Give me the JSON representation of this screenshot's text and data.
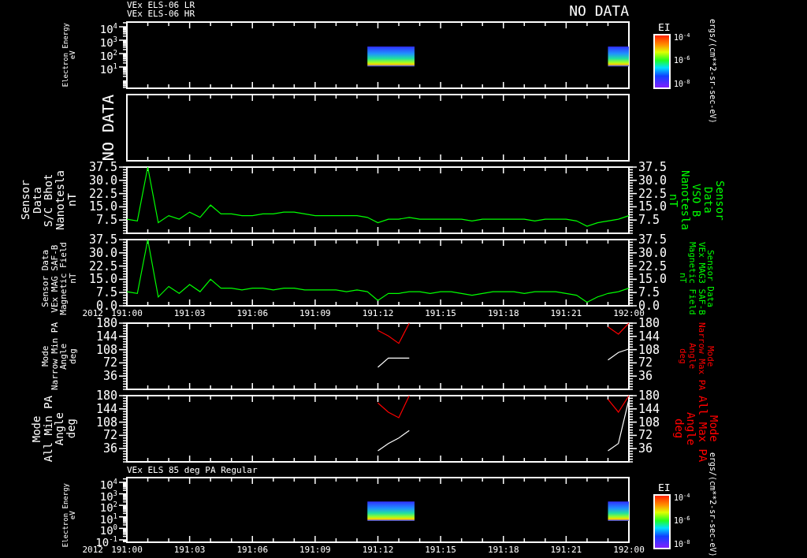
{
  "header": {
    "titles": [
      "VEx ELS-06 LR",
      "VEx ELS-06 HR"
    ],
    "status": "NO DATA"
  },
  "panels": [
    {
      "kind": "spectrogram",
      "label": [
        "Electron Energy",
        "eV"
      ],
      "yticks": [
        "10$^{4}$",
        "10$^{3}$",
        "10$^{2}$",
        "10$^{1}$"
      ],
      "colorbar": {
        "title": "EI",
        "ticks": [
          "10$^{-4}$",
          "10$^{-6}$",
          "10$^{-8}$"
        ],
        "unit": "ergs/(cm**2-sr-sec-eV)"
      }
    },
    {
      "kind": "empty",
      "message": "NO DATA"
    },
    {
      "kind": "line",
      "label": [
        "Sensor Data",
        "S/C Bhot",
        "Nanotesla",
        "nT"
      ],
      "right_label": [
        "Sensor Data",
        "VSO B",
        "Nanotesla",
        "nT"
      ],
      "right_ticks": [
        "37.5",
        "30.0",
        "22.5",
        "15.0",
        "7.5"
      ],
      "chart_data": {
        "type": "line",
        "categories": [
          null,
          null,
          null,
          null,
          null,
          null,
          null,
          null,
          null,
          null,
          null,
          null,
          null,
          null,
          null,
          null,
          null,
          null,
          null,
          null,
          null,
          null,
          null,
          null,
          null,
          null,
          null,
          null,
          null,
          null,
          null,
          null,
          null,
          null,
          null,
          null,
          null,
          null,
          null,
          null,
          null,
          null,
          null,
          null,
          null,
          null,
          null,
          null,
          null
        ],
        "ylim": [
          0,
          37.5
        ],
        "yticks": [
          {
            "value": 37.5,
            "label": "37.5"
          },
          {
            "value": 30,
            "label": "30.0"
          },
          {
            "value": 22.5,
            "label": "22.5"
          },
          {
            "value": 15,
            "label": "15.0"
          },
          {
            "value": 7.5,
            "label": "7.5"
          }
        ],
        "series": [
          {
            "color": "#00ff00",
            "values": [
              8,
              7,
              37.5,
              6,
              10,
              8,
              12,
              9,
              16,
              11,
              11,
              10,
              10,
              11,
              11,
              12,
              12,
              11,
              10,
              10,
              10,
              10,
              10,
              9,
              6,
              8,
              8,
              9,
              8,
              8,
              8,
              8,
              8,
              7,
              8,
              8,
              8,
              8,
              8,
              7,
              8,
              8,
              8,
              7,
              4,
              6,
              7,
              8,
              10
            ]
          }
        ]
      }
    },
    {
      "kind": "line",
      "label": [
        "Sensor Data",
        "VEx MAG SAF-B",
        "Magnetic Field",
        "nT"
      ],
      "right_label": [
        "Sensor Data",
        "VEx MAG3 SAF-B",
        "Magnetic Field",
        "nT"
      ],
      "right_ticks": [
        "37.5",
        "30.0",
        "22.5",
        "15.0",
        "7.5",
        "0.0"
      ],
      "year": "2012",
      "chart_data": {
        "type": "line",
        "categories": [
          "191:00",
          null,
          null,
          null,
          null,
          null,
          "191:03",
          null,
          null,
          null,
          null,
          null,
          "191:06",
          null,
          null,
          null,
          null,
          null,
          "191:09",
          null,
          null,
          null,
          null,
          null,
          "191:12",
          null,
          null,
          null,
          null,
          null,
          "191:15",
          null,
          null,
          null,
          null,
          null,
          "191:18",
          null,
          null,
          null,
          null,
          null,
          "191:21",
          null,
          null,
          null,
          null,
          null,
          "192:00"
        ],
        "ylim": [
          0,
          37.5
        ],
        "yticks": [
          {
            "value": 37.5,
            "label": "37.5"
          },
          {
            "value": 30,
            "label": "30.0"
          },
          {
            "value": 22.5,
            "label": "22.5"
          },
          {
            "value": 15,
            "label": "15.0"
          },
          {
            "value": 7.5,
            "label": "7.5"
          },
          {
            "value": 0,
            "label": "0.0"
          }
        ],
        "series": [
          {
            "color": "#00ff00",
            "values": [
              8,
              7,
              37.5,
              5,
              11,
              7,
              12,
              8,
              15,
              10,
              10,
              9,
              10,
              10,
              9,
              10,
              10,
              9,
              9,
              9,
              9,
              8,
              9,
              8,
              3,
              7,
              7,
              8,
              8,
              7,
              8,
              8,
              7,
              6,
              7,
              8,
              8,
              8,
              7,
              8,
              8,
              8,
              7,
              6,
              2,
              5,
              7,
              8,
              10
            ]
          }
        ]
      }
    },
    {
      "kind": "line",
      "label": [
        "Mode",
        "Narrow Min PA",
        "Angle",
        "deg"
      ],
      "right_label": [
        "Mode",
        "Narrow Max PA",
        "Angle",
        "deg"
      ],
      "right_ticks": [
        "180",
        "144",
        "108",
        "72",
        "36"
      ],
      "chart_data": {
        "type": "line",
        "categories": [
          null,
          null,
          null,
          null,
          null,
          null,
          null,
          null,
          null,
          null,
          null,
          null,
          null,
          null,
          null,
          null,
          null,
          null,
          null,
          null,
          null,
          null,
          null,
          null,
          null,
          null,
          null,
          null,
          null,
          null,
          null,
          null,
          null,
          null,
          null,
          null,
          null,
          null,
          null,
          null,
          null,
          null,
          null,
          null,
          null,
          null,
          null,
          null,
          null
        ],
        "ylim": [
          0,
          180
        ],
        "yticks": [
          {
            "value": 180,
            "label": "180"
          },
          {
            "value": 144,
            "label": "144"
          },
          {
            "value": 108,
            "label": "108"
          },
          {
            "value": 72,
            "label": "72"
          },
          {
            "value": 36,
            "label": "36"
          }
        ],
        "series": [
          {
            "color": "#ff0000",
            "values": [
              null,
              null,
              null,
              null,
              null,
              null,
              null,
              null,
              null,
              null,
              null,
              null,
              null,
              null,
              null,
              null,
              null,
              null,
              null,
              null,
              null,
              null,
              null,
              null,
              160,
              145,
              125,
              180,
              null,
              null,
              null,
              null,
              null,
              null,
              null,
              null,
              null,
              null,
              null,
              null,
              null,
              null,
              null,
              null,
              null,
              null,
              170,
              150,
              180
            ]
          },
          {
            "color": "#ffffff",
            "values": [
              null,
              null,
              null,
              null,
              null,
              null,
              null,
              null,
              null,
              null,
              null,
              null,
              null,
              null,
              null,
              null,
              null,
              null,
              null,
              null,
              null,
              null,
              null,
              null,
              60,
              85,
              85,
              85,
              null,
              null,
              null,
              null,
              null,
              null,
              null,
              null,
              null,
              null,
              null,
              null,
              null,
              null,
              null,
              null,
              null,
              null,
              80,
              100,
              110
            ]
          }
        ]
      }
    },
    {
      "kind": "line",
      "label": [
        "Mode",
        "All Min PA",
        "Angle",
        "deg"
      ],
      "right_label": [
        "Mode",
        "All Max PA",
        "Angle",
        "deg"
      ],
      "right_ticks": [
        "180",
        "144",
        "108",
        "72",
        "36"
      ],
      "chart_data": {
        "type": "line",
        "categories": [
          null,
          null,
          null,
          null,
          null,
          null,
          null,
          null,
          null,
          null,
          null,
          null,
          null,
          null,
          null,
          null,
          null,
          null,
          null,
          null,
          null,
          null,
          null,
          null,
          null,
          null,
          null,
          null,
          null,
          null,
          null,
          null,
          null,
          null,
          null,
          null,
          null,
          null,
          null,
          null,
          null,
          null,
          null,
          null,
          null,
          null,
          null,
          null,
          null
        ],
        "ylim": [
          0,
          180
        ],
        "yticks": [
          {
            "value": 180,
            "label": "180"
          },
          {
            "value": 144,
            "label": "144"
          },
          {
            "value": 108,
            "label": "108"
          },
          {
            "value": 72,
            "label": "72"
          },
          {
            "value": 36,
            "label": "36"
          }
        ],
        "series": [
          {
            "color": "#ff0000",
            "values": [
              null,
              null,
              null,
              null,
              null,
              null,
              null,
              null,
              null,
              null,
              null,
              null,
              null,
              null,
              null,
              null,
              null,
              null,
              null,
              null,
              null,
              null,
              null,
              null,
              160,
              135,
              120,
              180,
              null,
              null,
              null,
              null,
              null,
              null,
              null,
              null,
              null,
              null,
              null,
              null,
              null,
              null,
              null,
              null,
              null,
              null,
              170,
              135,
              180
            ]
          },
          {
            "color": "#ffffff",
            "values": [
              null,
              null,
              null,
              null,
              null,
              null,
              null,
              null,
              null,
              null,
              null,
              null,
              null,
              null,
              null,
              null,
              null,
              null,
              null,
              null,
              null,
              null,
              null,
              null,
              30,
              50,
              65,
              85,
              null,
              null,
              null,
              null,
              null,
              null,
              null,
              null,
              null,
              null,
              null,
              null,
              null,
              null,
              null,
              null,
              null,
              null,
              30,
              50,
              170
            ]
          }
        ]
      }
    },
    {
      "kind": "spectrogram",
      "title": "VEx ELS 85 deg PA Regular",
      "label": [
        "Electron Energy",
        "eV"
      ],
      "year": "2012",
      "yticks": [
        "10$^{4}$",
        "10$^{3}$",
        "10$^{2}$",
        "10$^{1}$",
        "10$^{0}$",
        "10$^{-1}$"
      ],
      "time_labels": [
        "191:00",
        "191:03",
        "191:06",
        "191:09",
        "191:12",
        "191:15",
        "191:18",
        "191:21",
        "192:00"
      ],
      "colorbar": {
        "title": "EI",
        "ticks": [
          "10$^{-4}$",
          "10$^{-6}$",
          "10$^{-8}$"
        ],
        "unit": "ergs/(cm**2-sr-sec-eV)"
      }
    }
  ]
}
